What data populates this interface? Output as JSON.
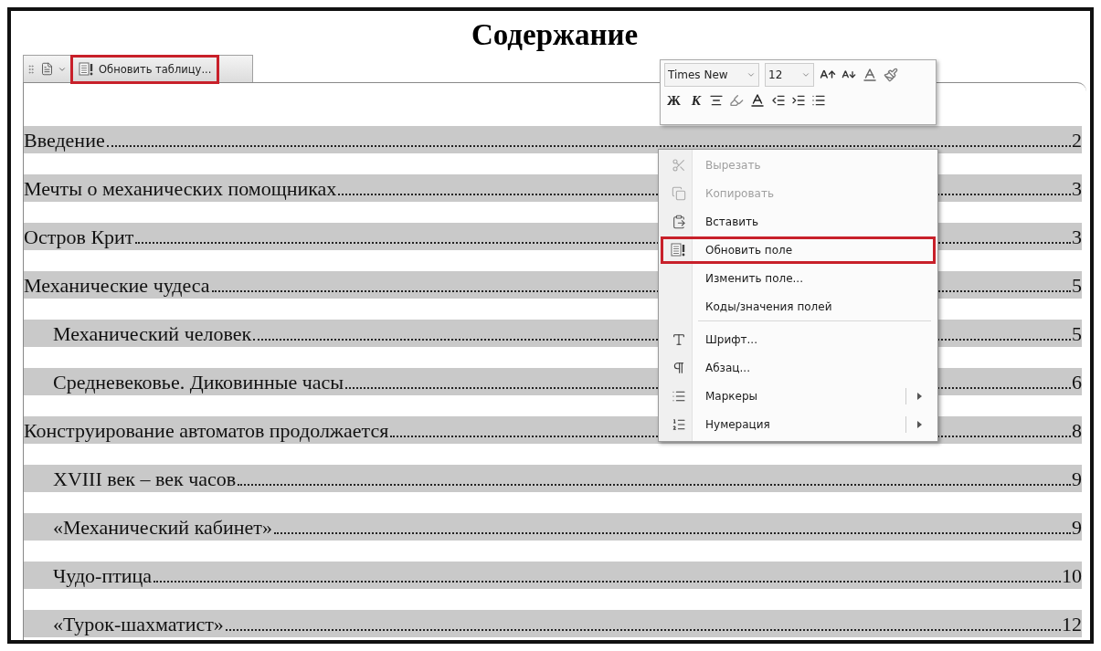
{
  "title": "Содержание",
  "toc_toolbar": {
    "button": {
      "label": "Обновить таблицу...",
      "highlighted": true
    }
  },
  "toc": [
    {
      "title": "Введение",
      "page": "2"
    },
    {
      "title": "Мечты о механических помощниках",
      "page": "3"
    },
    {
      "title": "Остров Крит",
      "page": "3"
    },
    {
      "title": "Механические чудеса",
      "page": "5",
      "children": [
        {
          "title": "Механический человек",
          "page": "5"
        },
        {
          "title": "Средневековье. Диковинные часы",
          "page": "6"
        }
      ]
    },
    {
      "title": "Конструирование автоматов продолжается",
      "page": "8",
      "children": [
        {
          "title": "XVIII век – век часов",
          "page": "9"
        },
        {
          "title": "«Механический кабинет»",
          "page": "9"
        },
        {
          "title": "Чудо-птица",
          "page": "10"
        },
        {
          "title": "«Турок-шахматист»",
          "page": "12"
        }
      ]
    }
  ],
  "mini_toolbar": {
    "font": "Times New",
    "size": "12",
    "bold": "Ж",
    "italic": "К"
  },
  "context_menu": [
    {
      "label": "Вырезать",
      "disabled": true,
      "highlighted": false,
      "submenu": false,
      "separator_after": false
    },
    {
      "label": "Копировать",
      "disabled": true,
      "highlighted": false,
      "submenu": false,
      "separator_after": false
    },
    {
      "label": "Вставить",
      "disabled": false,
      "highlighted": false,
      "submenu": false,
      "separator_after": false
    },
    {
      "label": "Обновить поле",
      "disabled": false,
      "highlighted": true,
      "submenu": false,
      "separator_after": false
    },
    {
      "label": "Изменить поле...",
      "disabled": false,
      "highlighted": false,
      "submenu": false,
      "separator_after": false
    },
    {
      "label": "Коды/значения полей",
      "disabled": false,
      "highlighted": false,
      "submenu": false,
      "separator_after": true
    },
    {
      "label": "Шрифт...",
      "disabled": false,
      "highlighted": false,
      "submenu": false,
      "separator_after": false
    },
    {
      "label": "Абзац...",
      "disabled": false,
      "highlighted": false,
      "submenu": false,
      "separator_after": false
    },
    {
      "label": "Маркеры",
      "disabled": false,
      "highlighted": false,
      "submenu": true,
      "separator_after": false
    },
    {
      "label": "Нумерация",
      "disabled": false,
      "highlighted": false,
      "submenu": true,
      "separator_after": false
    }
  ]
}
